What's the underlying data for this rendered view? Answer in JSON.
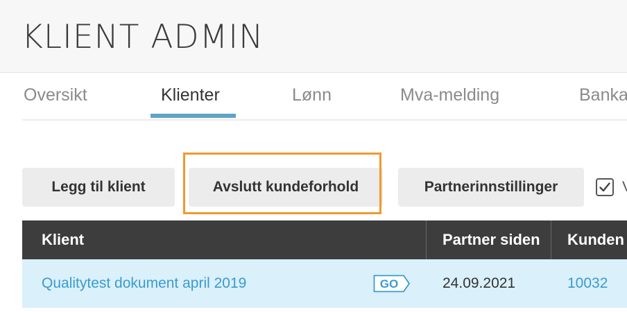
{
  "header": {
    "title": "KLIENT ADMIN"
  },
  "tabs": [
    {
      "label": "Oversikt"
    },
    {
      "label": "Klienter"
    },
    {
      "label": "Lønn"
    },
    {
      "label": "Mva-melding"
    },
    {
      "label": "Bankav"
    }
  ],
  "actions": {
    "add_client": "Legg til klient",
    "end_customer": "Avslutt kundeforhold",
    "partner_settings": "Partnerinnstillinger",
    "checkbox_label": "V"
  },
  "table": {
    "columns": [
      "Klient",
      "Partner siden",
      "Kunden"
    ],
    "rows": [
      {
        "client": "Qualitytest dokument april 2019",
        "badge": "GO",
        "partner_since": "24.09.2021",
        "customer_no": "10032"
      }
    ]
  },
  "colors": {
    "accent": "#5ea4c7",
    "highlight": "#f0992e",
    "link": "#3a9bd0",
    "row_selected": "#daf0fa"
  },
  "icons": [
    "checkmark-icon",
    "go-badge-icon"
  ]
}
